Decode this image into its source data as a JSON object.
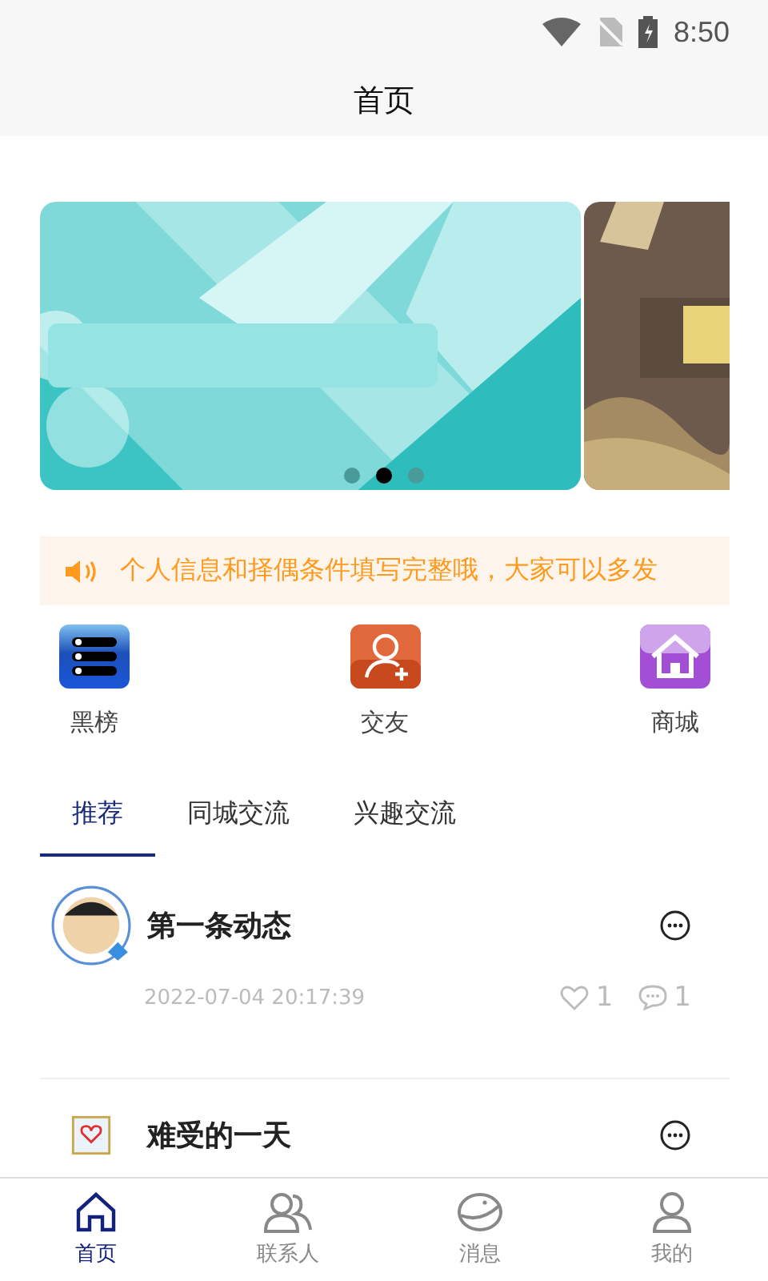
{
  "status_bar": {
    "time": "8:50"
  },
  "header": {
    "title": "首页"
  },
  "banner": {
    "slides": [
      {
        "kind": "picture",
        "selected": true
      },
      {
        "kind": "picture",
        "selected": false
      }
    ],
    "dots": [
      {
        "selected": false
      },
      {
        "selected": true
      },
      {
        "selected": false
      }
    ]
  },
  "notice": {
    "text": "个人信息和择偶条件填写完整哦，大家可以多发"
  },
  "shortcuts": [
    {
      "label": "黑榜",
      "kind": "list"
    },
    {
      "label": "交友",
      "kind": "friend"
    },
    {
      "label": "商城",
      "kind": "shop"
    }
  ],
  "tabs": [
    {
      "label": "推荐",
      "selected": true
    },
    {
      "label": "同城交流",
      "selected": false
    },
    {
      "label": "兴趣交流",
      "selected": false
    }
  ],
  "posts": [
    {
      "title": "第一条动态",
      "time": "2022-07-04 20:17:39",
      "likes": "1",
      "comments": "1"
    },
    {
      "title": "难受的一天"
    }
  ],
  "nav": [
    {
      "label": "首页",
      "kind": "home",
      "selected": true
    },
    {
      "label": "联系人",
      "kind": "contacts",
      "selected": false
    },
    {
      "label": "消息",
      "kind": "message",
      "selected": false
    },
    {
      "label": "我的",
      "kind": "me",
      "selected": false
    }
  ]
}
